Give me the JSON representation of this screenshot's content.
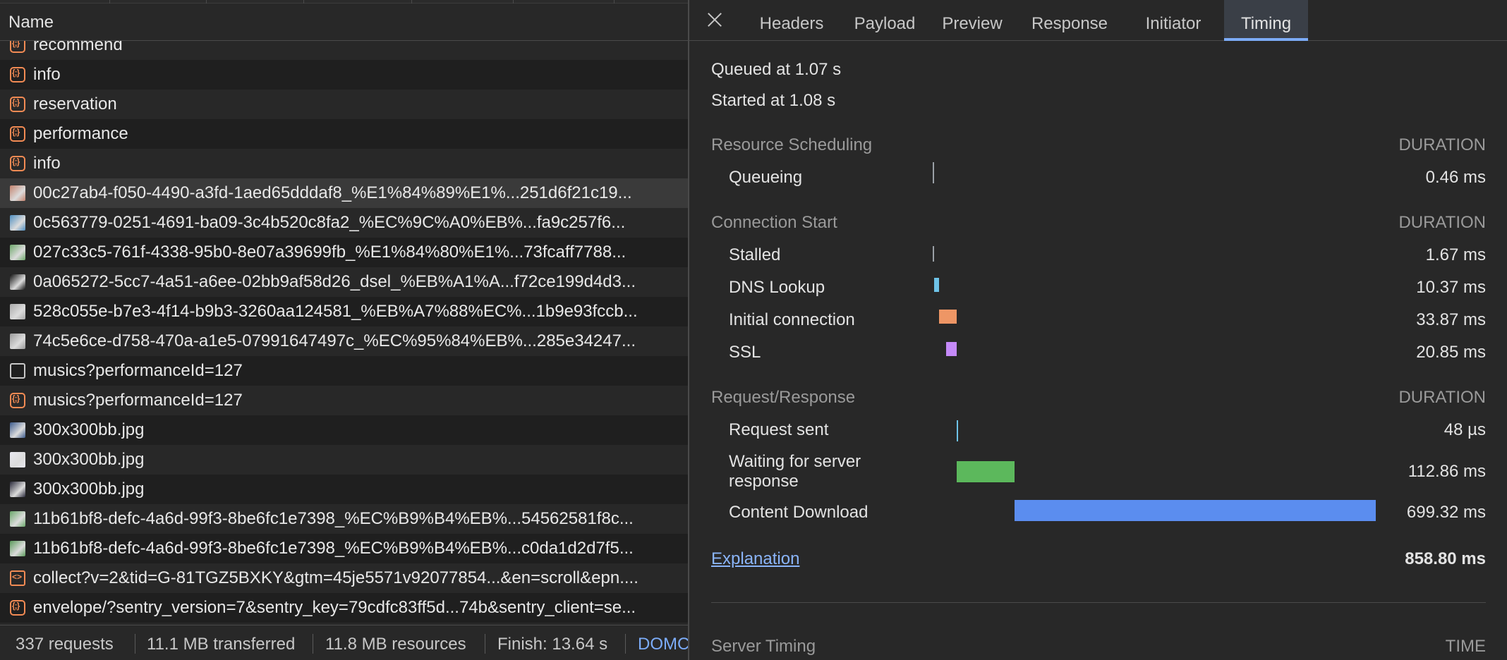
{
  "request_list": {
    "column_header": "Name",
    "rows": [
      {
        "icon": "json-icon",
        "name": "recommend"
      },
      {
        "icon": "json-icon",
        "name": "info"
      },
      {
        "icon": "json-icon",
        "name": "reservation"
      },
      {
        "icon": "json-icon",
        "name": "performance"
      },
      {
        "icon": "json-icon",
        "name": "info"
      },
      {
        "icon": "image-thumbnail-icon",
        "name": "00c27ab4-f050-4490-a3fd-1aed65dddaf8_%E1%84%89%E1%...251d6f21c19...",
        "selected": true
      },
      {
        "icon": "image-thumbnail-icon",
        "name": "0c563779-0251-4691-ba09-3c4b520c8fa2_%EC%9C%A0%EB%...fa9c257f6..."
      },
      {
        "icon": "image-thumbnail-icon",
        "name": "027c33c5-761f-4338-95b0-8e07a39699fb_%E1%84%80%E1%...73fcaff7788..."
      },
      {
        "icon": "image-thumbnail-icon",
        "name": "0a065272-5cc7-4a51-a6ee-02bb9af58d26_dsel_%EB%A1%A...f72ce199d4d3..."
      },
      {
        "icon": "image-thumbnail-icon",
        "name": "528c055e-b7e3-4f14-b9b3-3260aa124581_%EB%A7%88%EC%...1b9e93fccb..."
      },
      {
        "icon": "image-thumbnail-icon",
        "name": "74c5e6ce-d758-470a-a1e5-07991647497c_%EC%95%84%EB%...285e34247..."
      },
      {
        "icon": "document-icon",
        "name": "musics?performanceId=127"
      },
      {
        "icon": "json-icon",
        "name": "musics?performanceId=127"
      },
      {
        "icon": "image-thumbnail-icon",
        "name": "300x300bb.jpg"
      },
      {
        "icon": "image-thumbnail-icon",
        "name": "300x300bb.jpg"
      },
      {
        "icon": "image-thumbnail-icon",
        "name": "300x300bb.jpg"
      },
      {
        "icon": "image-thumbnail-icon",
        "name": "11b61bf8-defc-4a6d-99f3-8be6fc1e7398_%EC%B9%B4%EB%...54562581f8c..."
      },
      {
        "icon": "image-thumbnail-icon",
        "name": "11b61bf8-defc-4a6d-99f3-8be6fc1e7398_%EC%B9%B4%EB%...c0da1d2d7f5..."
      },
      {
        "icon": "script-icon",
        "name": "collect?v=2&tid=G-81TGZ5BXKY&gtm=45je5571v92077854...&en=scroll&epn...."
      },
      {
        "icon": "json-icon",
        "name": "envelope/?sentry_version=7&sentry_key=79cdfc83ff5d...74b&sentry_client=se..."
      }
    ]
  },
  "status_bar": {
    "requests": "337 requests",
    "transferred": "11.1 MB transferred",
    "resources": "11.8 MB resources",
    "finish": "Finish: 13.64 s",
    "domcontentloaded": "DOMC"
  },
  "detail_tabs": {
    "items": [
      "Headers",
      "Payload",
      "Preview",
      "Response",
      "Initiator",
      "Timing"
    ],
    "active": "Timing"
  },
  "timing": {
    "queued_at": "Queued at 1.07 s",
    "started_at": "Started at 1.08 s",
    "total_ms": 858.8,
    "sections": [
      {
        "title": "Resource Scheduling",
        "column": "DURATION",
        "phases": [
          {
            "label": "Queueing",
            "duration": "0.46 ms",
            "start_ms": 0,
            "ms": 0.46,
            "color": "#9aa0a6"
          }
        ]
      },
      {
        "title": "Connection Start",
        "column": "DURATION",
        "phases": [
          {
            "label": "Stalled",
            "duration": "1.67 ms",
            "start_ms": 0.46,
            "ms": 1.67,
            "color": "#9aa0a6"
          },
          {
            "label": "DNS Lookup",
            "duration": "10.37 ms",
            "start_ms": 2.13,
            "ms": 10.37,
            "color": "#6ec3e8"
          },
          {
            "label": "Initial connection",
            "duration": "33.87 ms",
            "start_ms": 12.5,
            "ms": 33.87,
            "color": "#ee9665"
          },
          {
            "label": "SSL",
            "duration": "20.85 ms",
            "start_ms": 25.5,
            "ms": 20.85,
            "color": "#c58af9"
          }
        ]
      },
      {
        "title": "Request/Response",
        "column": "DURATION",
        "phases": [
          {
            "label": "Request sent",
            "duration": "48 µs",
            "start_ms": 46.37,
            "ms": 0.048,
            "color": "#6ec3e8"
          },
          {
            "label": "Waiting for server response",
            "duration": "112.86 ms",
            "start_ms": 46.42,
            "ms": 112.86,
            "color": "#5cb85c"
          },
          {
            "label": "Content Download",
            "duration": "699.32 ms",
            "start_ms": 159.28,
            "ms": 699.32,
            "color": "#5b8def"
          }
        ]
      }
    ],
    "explanation_link": "Explanation",
    "total": "858.80 ms",
    "server_timing": {
      "title": "Server Timing",
      "column": "TIME"
    }
  }
}
